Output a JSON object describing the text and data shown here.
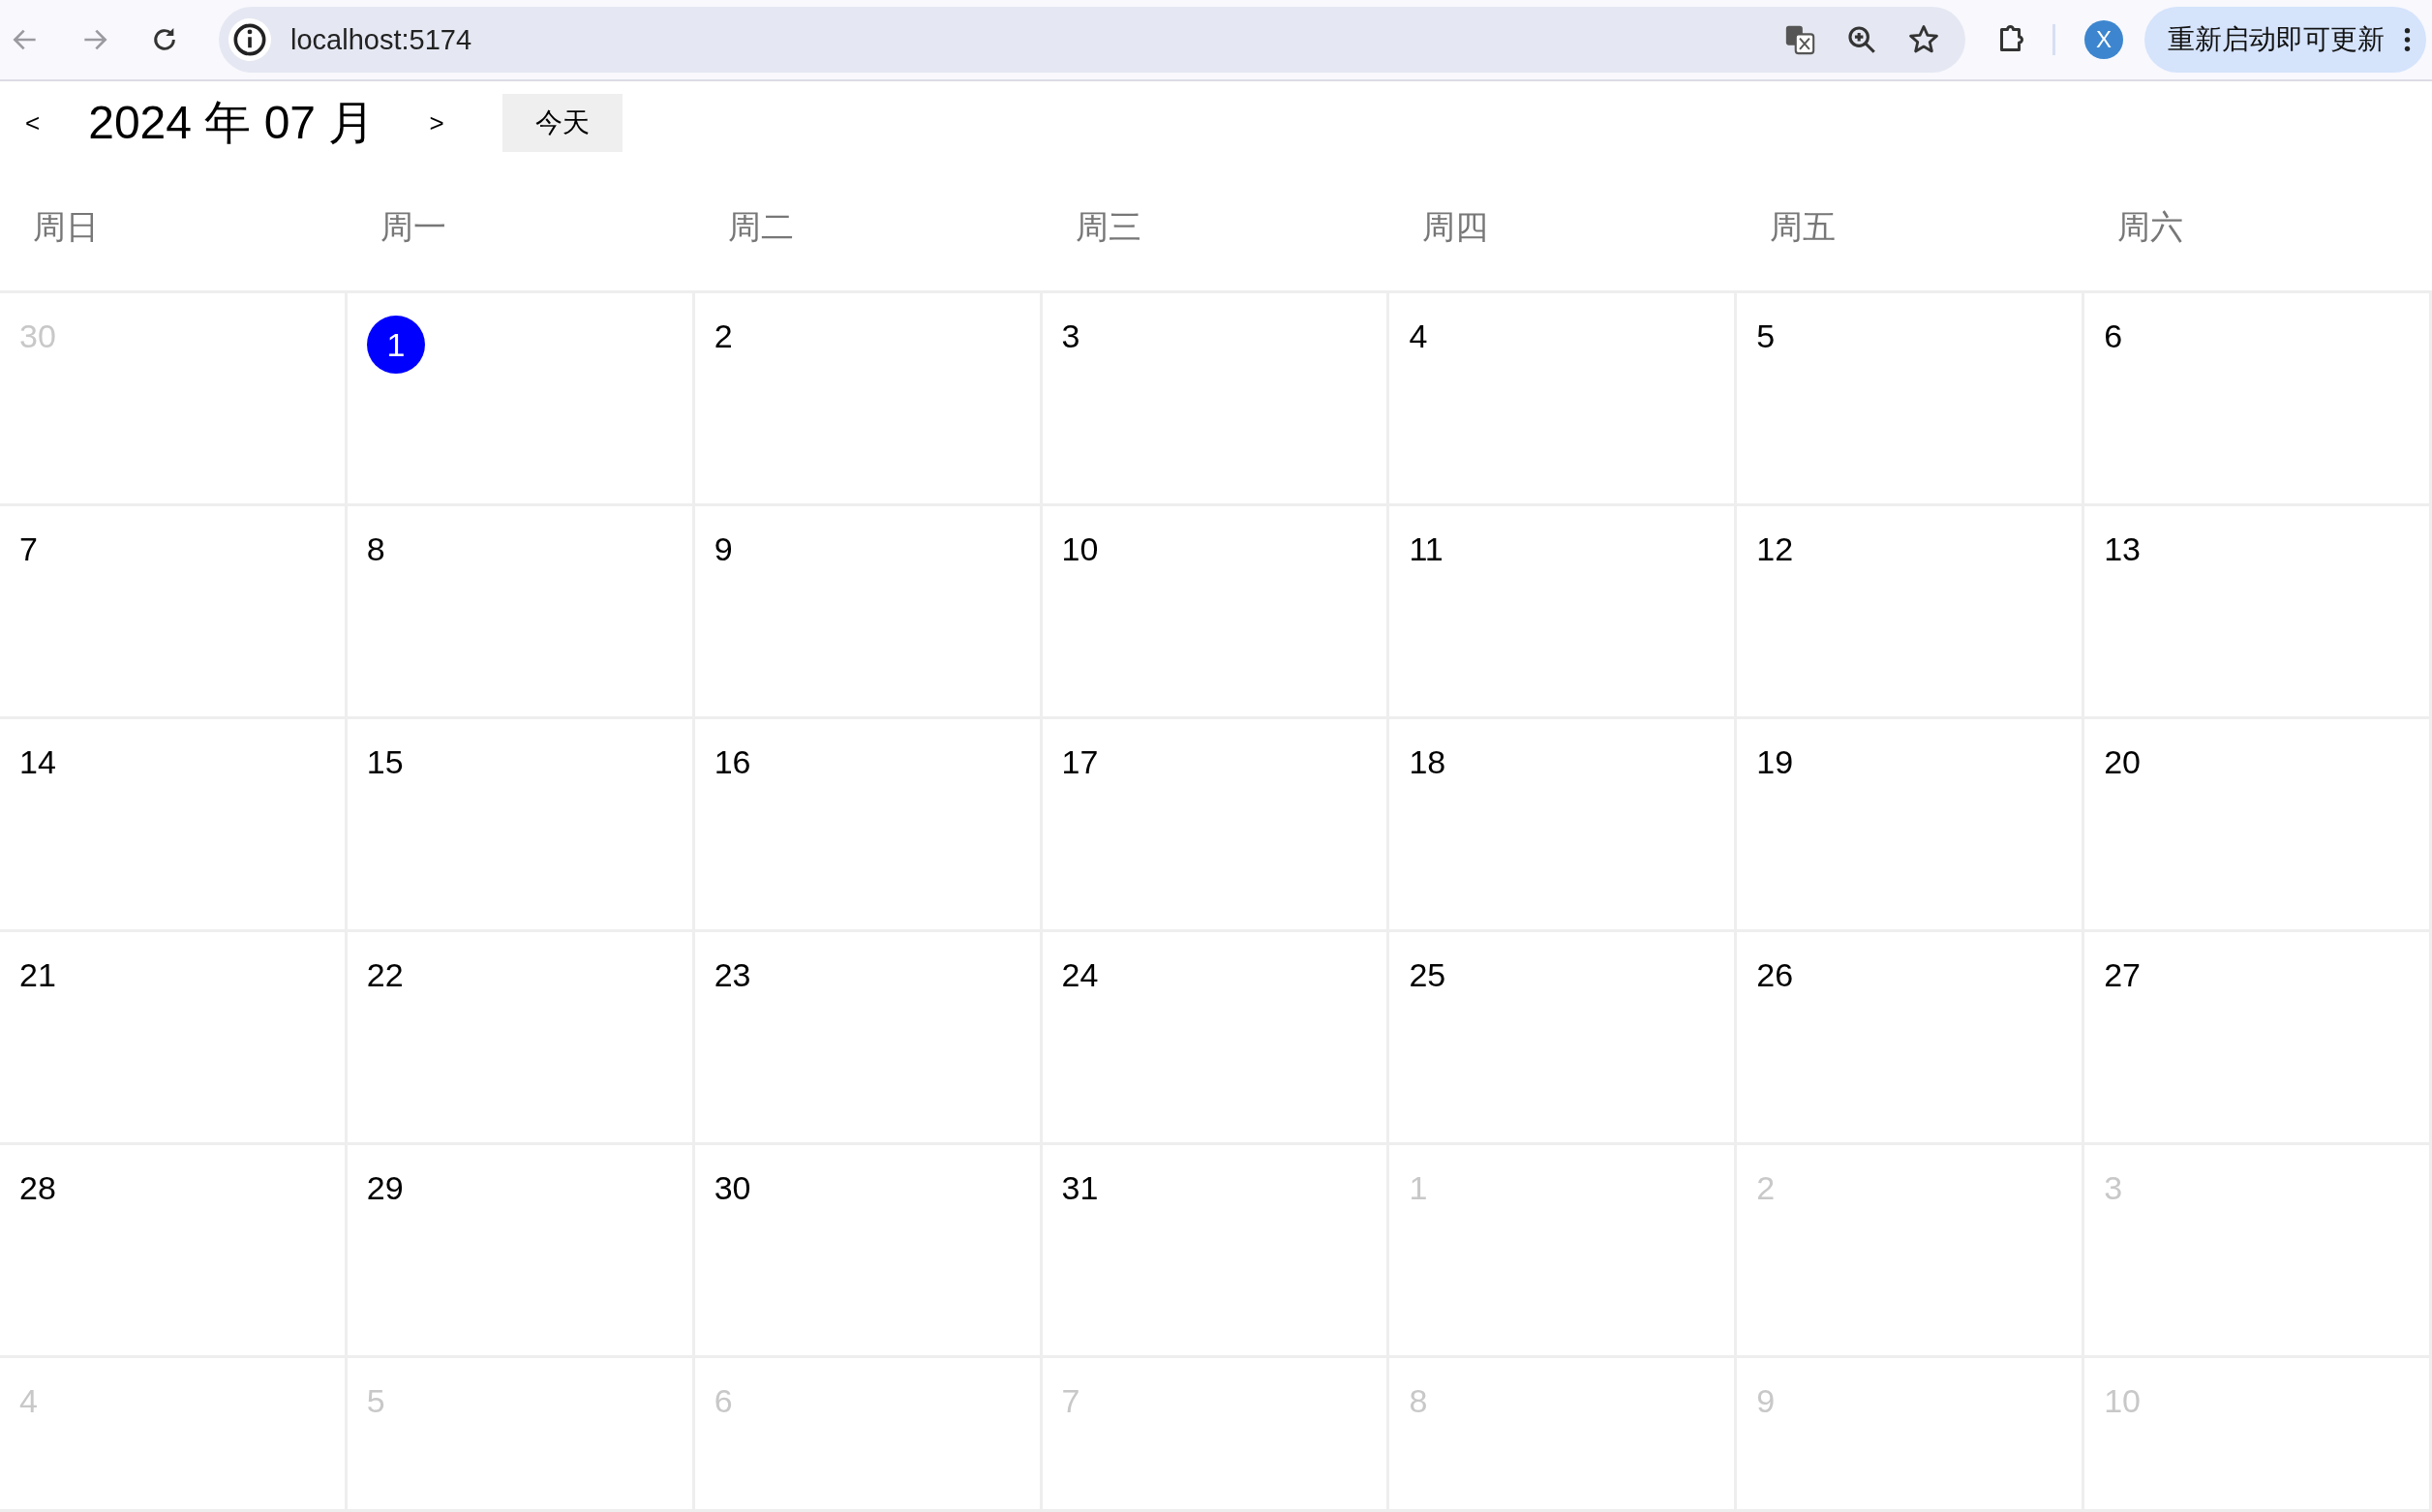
{
  "browser": {
    "url": "localhost:5174",
    "profile_initial": "X",
    "update_button": "重新启动即可更新"
  },
  "calendar": {
    "prev": "<",
    "title": "2024 年 07 月",
    "next": ">",
    "today_button": "今天",
    "weekdays": [
      "周日",
      "周一",
      "周二",
      "周三",
      "周四",
      "周五",
      "周六"
    ],
    "days": [
      {
        "label": "30",
        "current_month": false,
        "selected": false
      },
      {
        "label": "1",
        "current_month": true,
        "selected": true
      },
      {
        "label": "2",
        "current_month": true,
        "selected": false
      },
      {
        "label": "3",
        "current_month": true,
        "selected": false
      },
      {
        "label": "4",
        "current_month": true,
        "selected": false
      },
      {
        "label": "5",
        "current_month": true,
        "selected": false
      },
      {
        "label": "6",
        "current_month": true,
        "selected": false
      },
      {
        "label": "7",
        "current_month": true,
        "selected": false
      },
      {
        "label": "8",
        "current_month": true,
        "selected": false
      },
      {
        "label": "9",
        "current_month": true,
        "selected": false
      },
      {
        "label": "10",
        "current_month": true,
        "selected": false
      },
      {
        "label": "11",
        "current_month": true,
        "selected": false
      },
      {
        "label": "12",
        "current_month": true,
        "selected": false
      },
      {
        "label": "13",
        "current_month": true,
        "selected": false
      },
      {
        "label": "14",
        "current_month": true,
        "selected": false
      },
      {
        "label": "15",
        "current_month": true,
        "selected": false
      },
      {
        "label": "16",
        "current_month": true,
        "selected": false
      },
      {
        "label": "17",
        "current_month": true,
        "selected": false
      },
      {
        "label": "18",
        "current_month": true,
        "selected": false
      },
      {
        "label": "19",
        "current_month": true,
        "selected": false
      },
      {
        "label": "20",
        "current_month": true,
        "selected": false
      },
      {
        "label": "21",
        "current_month": true,
        "selected": false
      },
      {
        "label": "22",
        "current_month": true,
        "selected": false
      },
      {
        "label": "23",
        "current_month": true,
        "selected": false
      },
      {
        "label": "24",
        "current_month": true,
        "selected": false
      },
      {
        "label": "25",
        "current_month": true,
        "selected": false
      },
      {
        "label": "26",
        "current_month": true,
        "selected": false
      },
      {
        "label": "27",
        "current_month": true,
        "selected": false
      },
      {
        "label": "28",
        "current_month": true,
        "selected": false
      },
      {
        "label": "29",
        "current_month": true,
        "selected": false
      },
      {
        "label": "30",
        "current_month": true,
        "selected": false
      },
      {
        "label": "31",
        "current_month": true,
        "selected": false
      },
      {
        "label": "1",
        "current_month": false,
        "selected": false
      },
      {
        "label": "2",
        "current_month": false,
        "selected": false
      },
      {
        "label": "3",
        "current_month": false,
        "selected": false
      },
      {
        "label": "4",
        "current_month": false,
        "selected": false
      },
      {
        "label": "5",
        "current_month": false,
        "selected": false
      },
      {
        "label": "6",
        "current_month": false,
        "selected": false
      },
      {
        "label": "7",
        "current_month": false,
        "selected": false
      },
      {
        "label": "8",
        "current_month": false,
        "selected": false
      },
      {
        "label": "9",
        "current_month": false,
        "selected": false
      },
      {
        "label": "10",
        "current_month": false,
        "selected": false
      }
    ]
  }
}
